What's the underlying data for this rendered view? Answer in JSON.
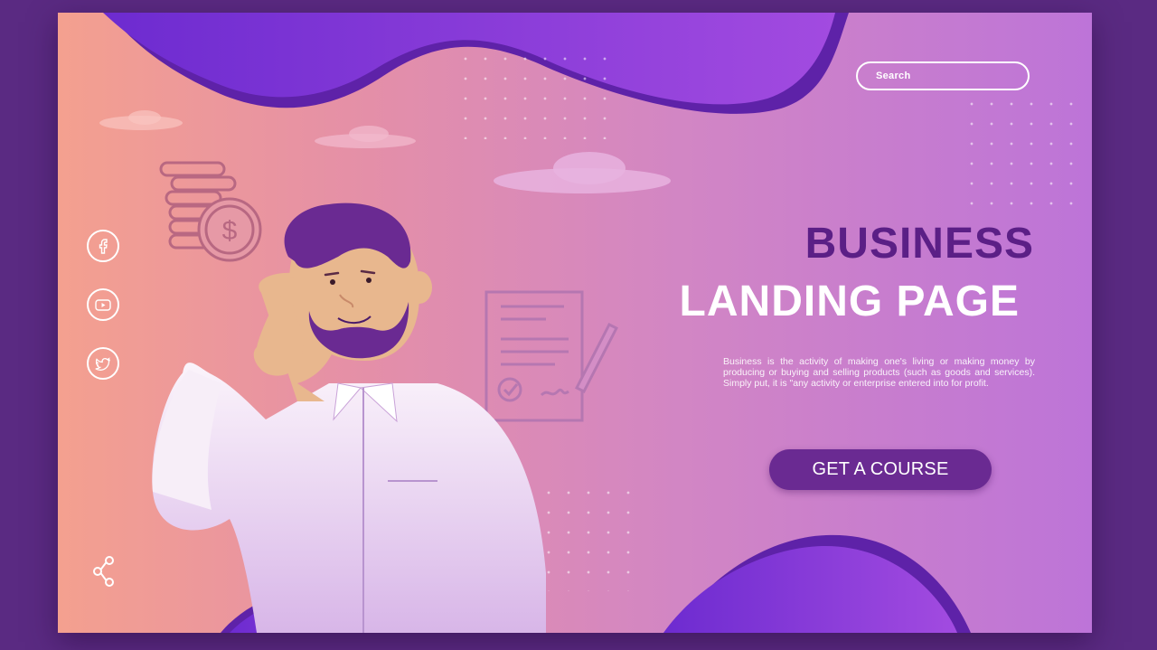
{
  "search": {
    "placeholder": "Search"
  },
  "hero": {
    "title_line1": "BUSINESS",
    "title_line2": "LANDING PAGE",
    "description": "Business is the activity of making one's living or making money by producing or buying and selling products (such as goods and services). Simply put, it is \"any activity or enterprise entered into for profit.",
    "cta_label": "GET A COURSE"
  },
  "social": [
    "facebook-icon",
    "youtube-icon",
    "twitter-icon",
    "share-icon"
  ],
  "colors": {
    "background": "#5a2a82",
    "accent_dark": "#5b1f86",
    "button": "#6a2a92",
    "blob": "#8b33d6",
    "gradient_left": "#f4a08f",
    "gradient_right": "#bd74d8"
  }
}
